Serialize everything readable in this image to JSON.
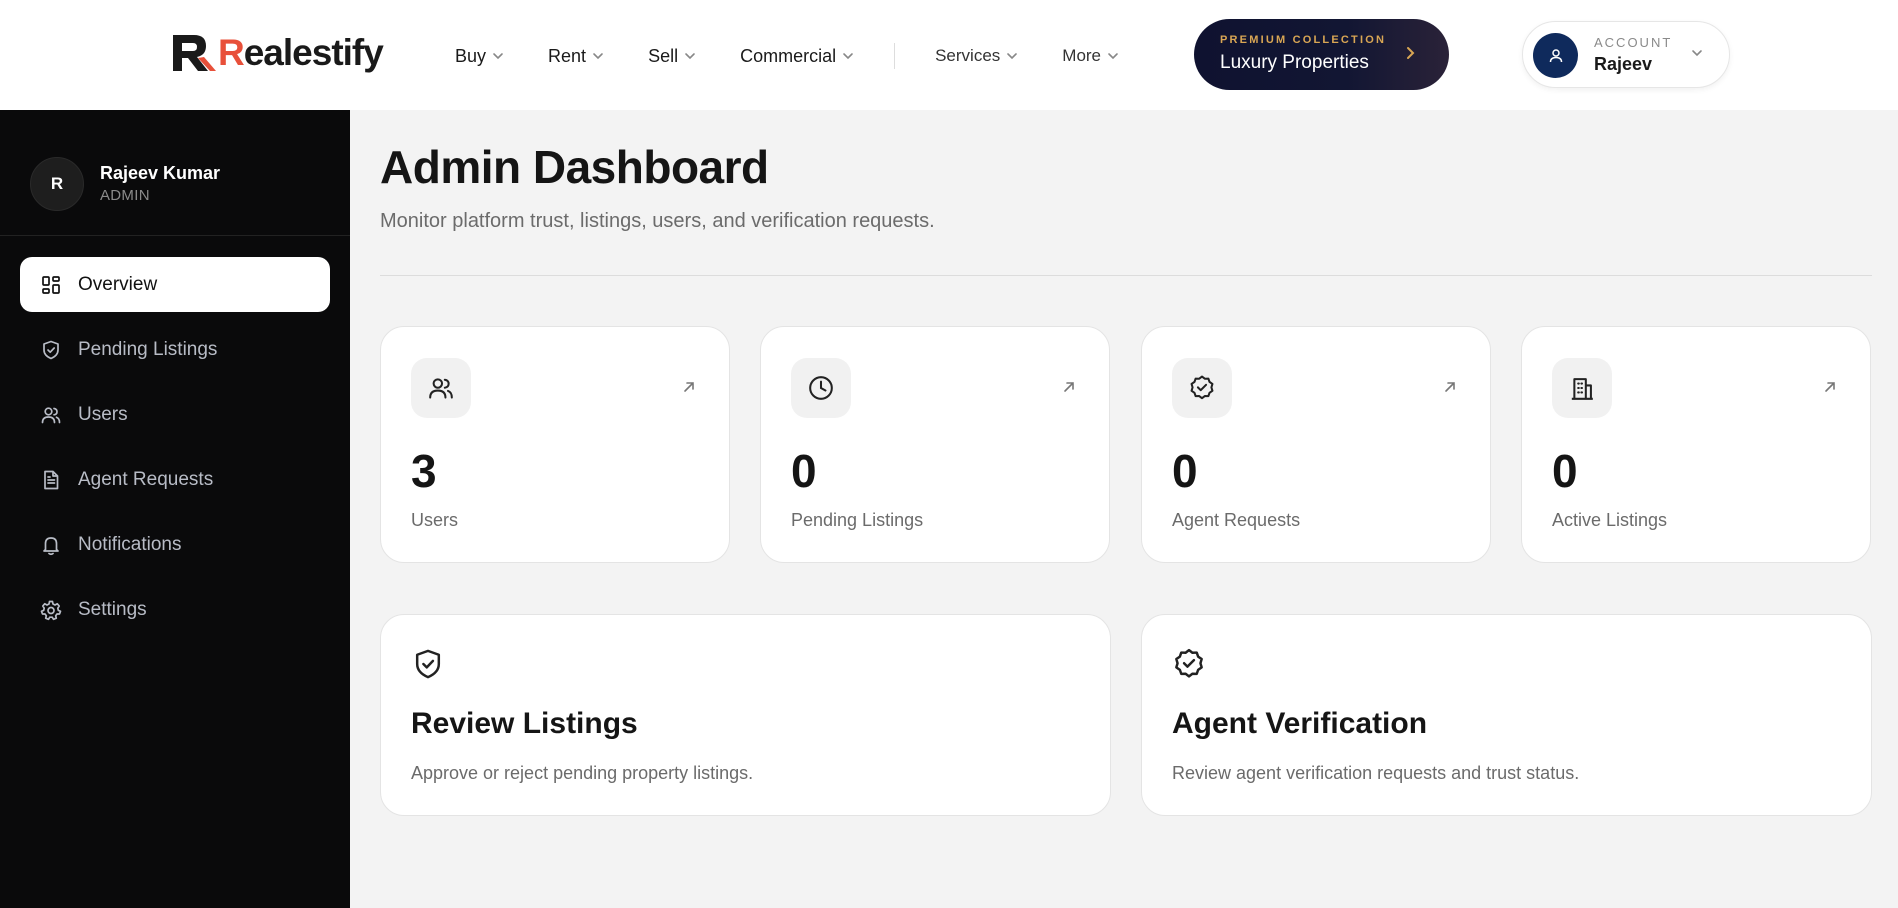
{
  "brand": {
    "name_first": "R",
    "name_rest": "ealestify",
    "accent_color": "#e8503a"
  },
  "nav": {
    "items": [
      {
        "label": "Buy",
        "icon": "chevron-down-icon"
      },
      {
        "label": "Rent",
        "icon": "chevron-down-icon"
      },
      {
        "label": "Sell",
        "icon": "chevron-down-icon"
      },
      {
        "label": "Commercial",
        "icon": "chevron-down-icon"
      }
    ],
    "secondary": [
      {
        "label": "Services",
        "icon": "chevron-down-icon"
      },
      {
        "label": "More",
        "icon": "chevron-down-icon"
      }
    ]
  },
  "premium": {
    "eyebrow": "PREMIUM COLLECTION",
    "title": "Luxury Properties",
    "accent_color": "#d9a654"
  },
  "account": {
    "label": "ACCOUNT",
    "name": "Rajeev"
  },
  "sidebar": {
    "profile": {
      "initial": "R",
      "name": "Rajeev Kumar",
      "role": "ADMIN"
    },
    "items": [
      {
        "label": "Overview",
        "icon": "grid-icon",
        "active": true
      },
      {
        "label": "Pending Listings",
        "icon": "shield-check-icon"
      },
      {
        "label": "Users",
        "icon": "users-icon"
      },
      {
        "label": "Agent Requests",
        "icon": "file-text-icon"
      },
      {
        "label": "Notifications",
        "icon": "bell-icon"
      },
      {
        "label": "Settings",
        "icon": "gear-icon"
      }
    ]
  },
  "main": {
    "title": "Admin Dashboard",
    "subtitle": "Monitor platform trust, listings, users, and verification requests.",
    "stats": [
      {
        "value": "3",
        "label": "Users",
        "icon": "users-icon"
      },
      {
        "value": "0",
        "label": "Pending Listings",
        "icon": "clock-icon"
      },
      {
        "value": "0",
        "label": "Agent Requests",
        "icon": "badge-check-icon"
      },
      {
        "value": "0",
        "label": "Active Listings",
        "icon": "building-icon"
      }
    ],
    "cards": [
      {
        "title": "Review Listings",
        "desc": "Approve or reject pending property listings.",
        "icon": "shield-check-icon"
      },
      {
        "title": "Agent Verification",
        "desc": "Review agent verification requests and trust status.",
        "icon": "badge-check-icon"
      }
    ]
  }
}
